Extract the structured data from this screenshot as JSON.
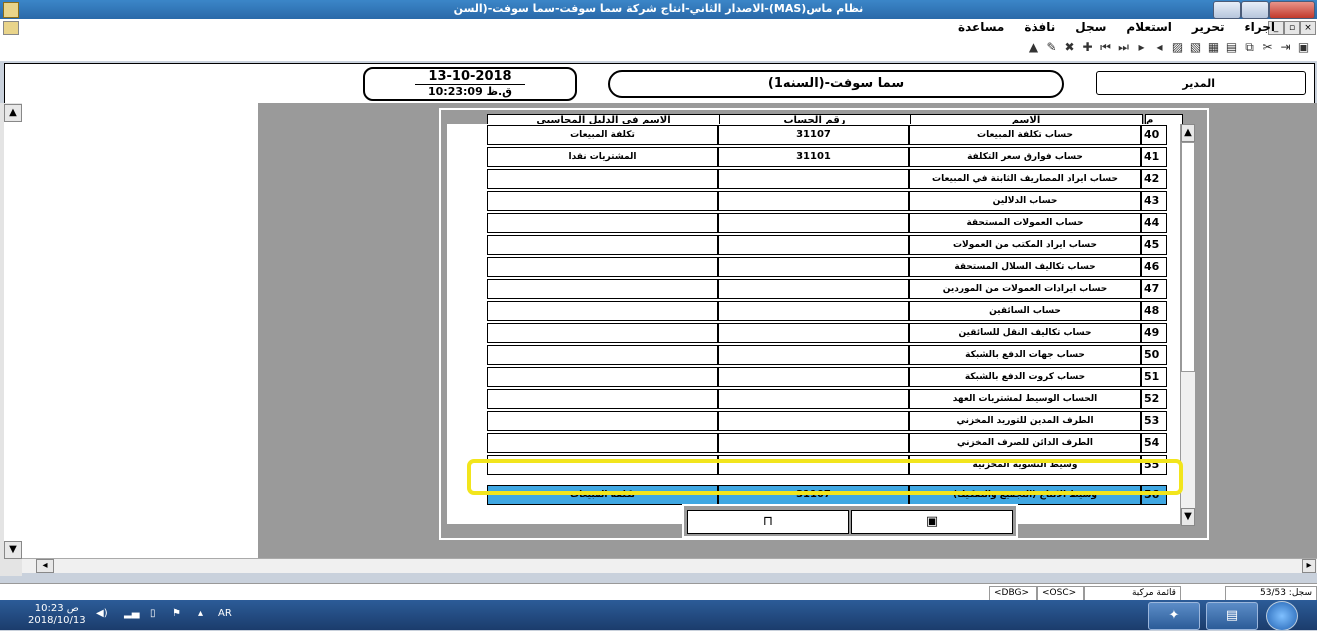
{
  "window": {
    "title": "نظام ماس(MAS)-الاصدار الثاني-انتاج شركة سما سوفت-سما سوفت-(السن"
  },
  "menu": {
    "items": [
      "اجراء",
      "تحرير",
      "استعلام",
      "سجل",
      "نافذة",
      "مساعدة"
    ]
  },
  "toolbar": {
    "icons": [
      "save-icon",
      "exit-icon",
      "cut-icon",
      "copy-icon",
      "paste-icon",
      "new-record-icon",
      "delete-icon",
      "print-icon",
      "previous-icon",
      "next-icon",
      "last-icon",
      "first-icon",
      "add-icon",
      "remove-icon",
      "search-icon",
      "pin-icon"
    ]
  },
  "header": {
    "date": "13-10-2018",
    "time": "10:23:09 ق.ظ",
    "company": "سما سوفت-(السنه1)",
    "user": "المدير"
  },
  "grid": {
    "columns": {
      "num": "م",
      "name": "الاسم",
      "account": "رقم الحساب",
      "guide_name": "الاسم في الدليل المحاسبي"
    },
    "rows": [
      {
        "num": "40",
        "name": "حساب تكلفة المبيعات",
        "account": "31107",
        "guide": "تكلفة المبيعات"
      },
      {
        "num": "41",
        "name": "حساب فوارق سعر التكلفة",
        "account": "31101",
        "guide": "المشتريات نقدا"
      },
      {
        "num": "42",
        "name": "حساب ايراد المصاريف الثابتة في المبيعات",
        "account": "",
        "guide": ""
      },
      {
        "num": "43",
        "name": "حساب الدلالين",
        "account": "",
        "guide": ""
      },
      {
        "num": "44",
        "name": "حساب العمولات المستحقة",
        "account": "",
        "guide": ""
      },
      {
        "num": "45",
        "name": "حساب ايراد المكتب من العمولات",
        "account": "",
        "guide": ""
      },
      {
        "num": "46",
        "name": "حساب تكاليف السلال المستحقة",
        "account": "",
        "guide": ""
      },
      {
        "num": "47",
        "name": "حساب ايرادات العمولات من الموردين",
        "account": "",
        "guide": ""
      },
      {
        "num": "48",
        "name": "حساب السائقين",
        "account": "",
        "guide": ""
      },
      {
        "num": "49",
        "name": "حساب تكاليف النقل للسائقين",
        "account": "",
        "guide": ""
      },
      {
        "num": "50",
        "name": "حساب جهات الدفع بالشبكة",
        "account": "",
        "guide": ""
      },
      {
        "num": "51",
        "name": "حساب كروت الدفع بالشبكة",
        "account": "",
        "guide": ""
      },
      {
        "num": "52",
        "name": "الحساب الوسيط لمشتريات العهد",
        "account": "",
        "guide": ""
      },
      {
        "num": "53",
        "name": "الطرف المدين للتوريد المخزني",
        "account": "",
        "guide": ""
      },
      {
        "num": "54",
        "name": "الطرف الدائن للصرف المخزني",
        "account": "",
        "guide": ""
      },
      {
        "num": "55",
        "name": "وسيط التسوية المخزنية",
        "account": "",
        "guide": ""
      },
      {
        "num": "56",
        "name": "وسيط الانتاج (التجميع والتفكيك)",
        "account": "31107",
        "guide": "تكلفة المبيعات"
      }
    ],
    "selected_index": 16
  },
  "dialog_buttons": {
    "save": "save-icon",
    "exit": "exit-door-icon"
  },
  "status": {
    "record": "سجل: 53/53",
    "mode": "قائمة مركبة",
    "osc": "<OSC>",
    "dbg": "<DBG>"
  },
  "taskbar": {
    "time": "10:23 ص",
    "date": "2018/10/13",
    "lang": "AR"
  }
}
